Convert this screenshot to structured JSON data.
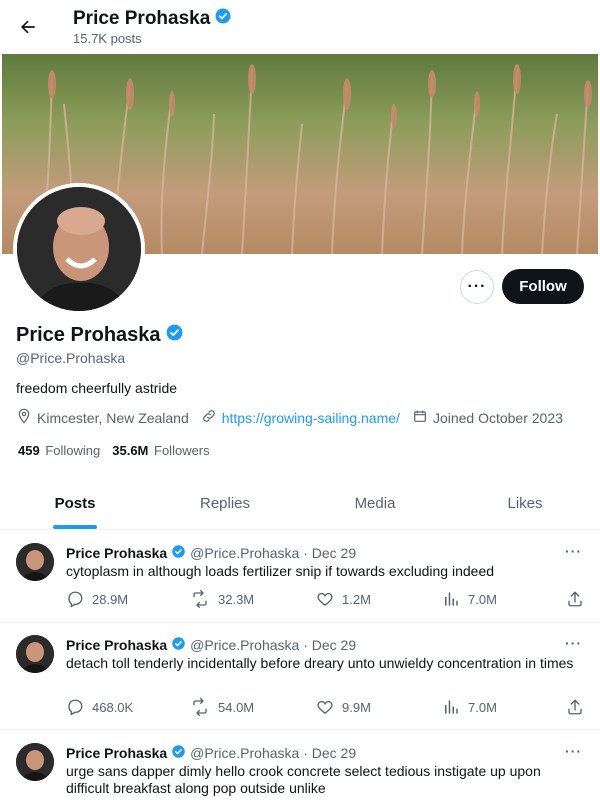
{
  "header": {
    "title": "Price Prohaska",
    "post_count": "15.7K posts"
  },
  "profile": {
    "name": "Price Prohaska",
    "handle": "@Price.Prohaska",
    "bio": "freedom cheerfully astride",
    "location": "Kimcester, New Zealand",
    "url": "https://growing-sailing.name/",
    "joined": "Joined October 2023",
    "following_count": "459",
    "following_label": "Following",
    "followers_count": "35.6M",
    "followers_label": "Followers",
    "follow_label": "Follow",
    "more_label": "···"
  },
  "tabs": [
    {
      "label": "Posts",
      "active": true
    },
    {
      "label": "Replies",
      "active": false
    },
    {
      "label": "Media",
      "active": false
    },
    {
      "label": "Likes",
      "active": false
    }
  ],
  "posts": [
    {
      "name": "Price Prohaska",
      "meta": "@Price.Prohaska · Dec 29",
      "text": "cytoplasm in although loads fertilizer snip if towards excluding indeed",
      "replies": "28.9M",
      "reposts": "32.3M",
      "likes": "1.2M",
      "views": "7.0M"
    },
    {
      "name": "Price Prohaska",
      "meta": "@Price.Prohaska · Dec 29",
      "text": "detach toll tenderly incidentally before dreary unto unwieldy concentration in times",
      "replies": "468.0K",
      "reposts": "54.0M",
      "likes": "9.9M",
      "views": "7.0M"
    },
    {
      "name": "Price Prohaska",
      "meta": "@Price.Prohaska · Dec 29",
      "text": "urge sans dapper dimly hello crook concrete select tedious instigate up upon difficult breakfast along pop outside unlike"
    }
  ],
  "colors": {
    "accent": "#1d9bf0",
    "text": "#0f1419",
    "muted": "#536471",
    "button_dark": "#0f1419"
  }
}
